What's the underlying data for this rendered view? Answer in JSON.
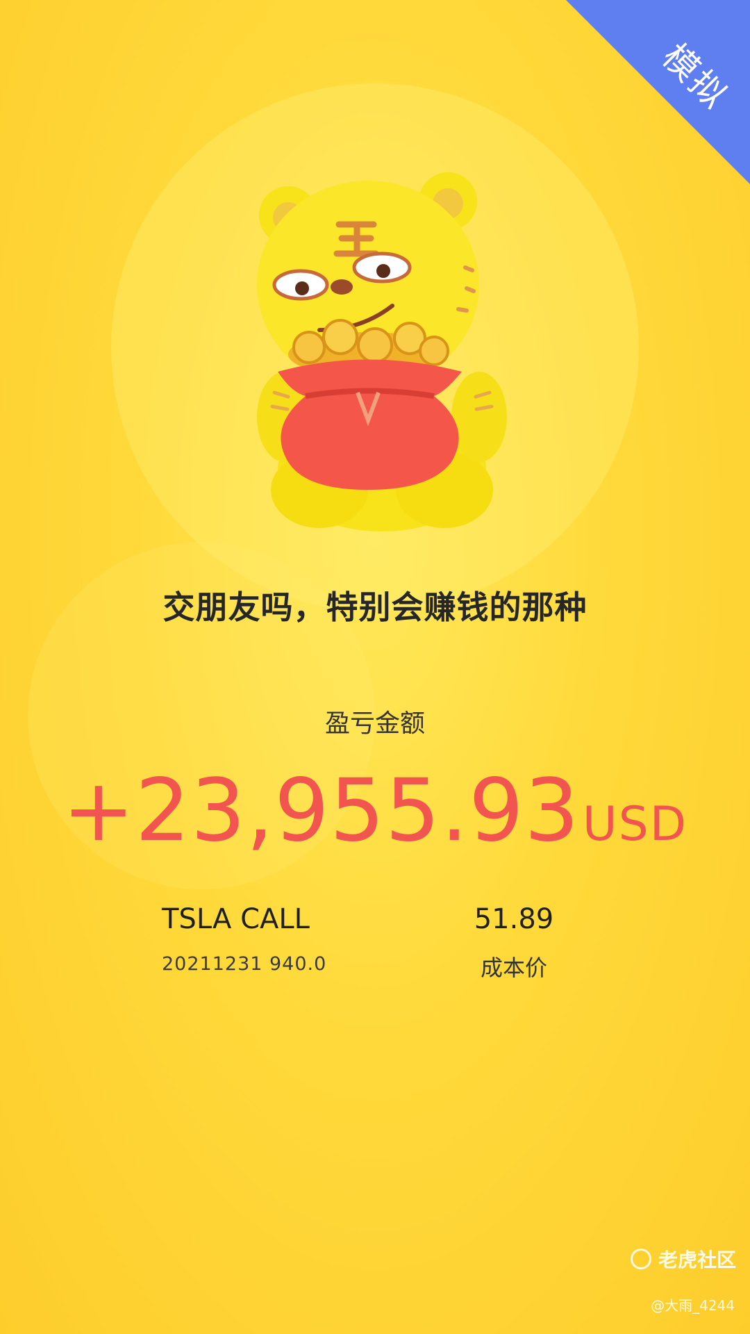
{
  "badge": {
    "label": "模拟"
  },
  "headline": "交朋友吗，特别会赚钱的那种",
  "profit": {
    "label": "盈亏金额",
    "amount": "+23,955.93",
    "currency": "USD"
  },
  "contract": {
    "name": "TSLA CALL",
    "expiry_strike": "20211231 940.0"
  },
  "cost": {
    "value": "51.89",
    "label": "成本价"
  },
  "watermark": {
    "brand": "老虎社区",
    "user": "@大雨_4244"
  },
  "colors": {
    "background": "#fdd435",
    "badge": "#5f7ef0",
    "profit": "#f25550"
  },
  "icons": [
    "tiger-mascot-illustration",
    "tiger-community-logo-icon"
  ]
}
